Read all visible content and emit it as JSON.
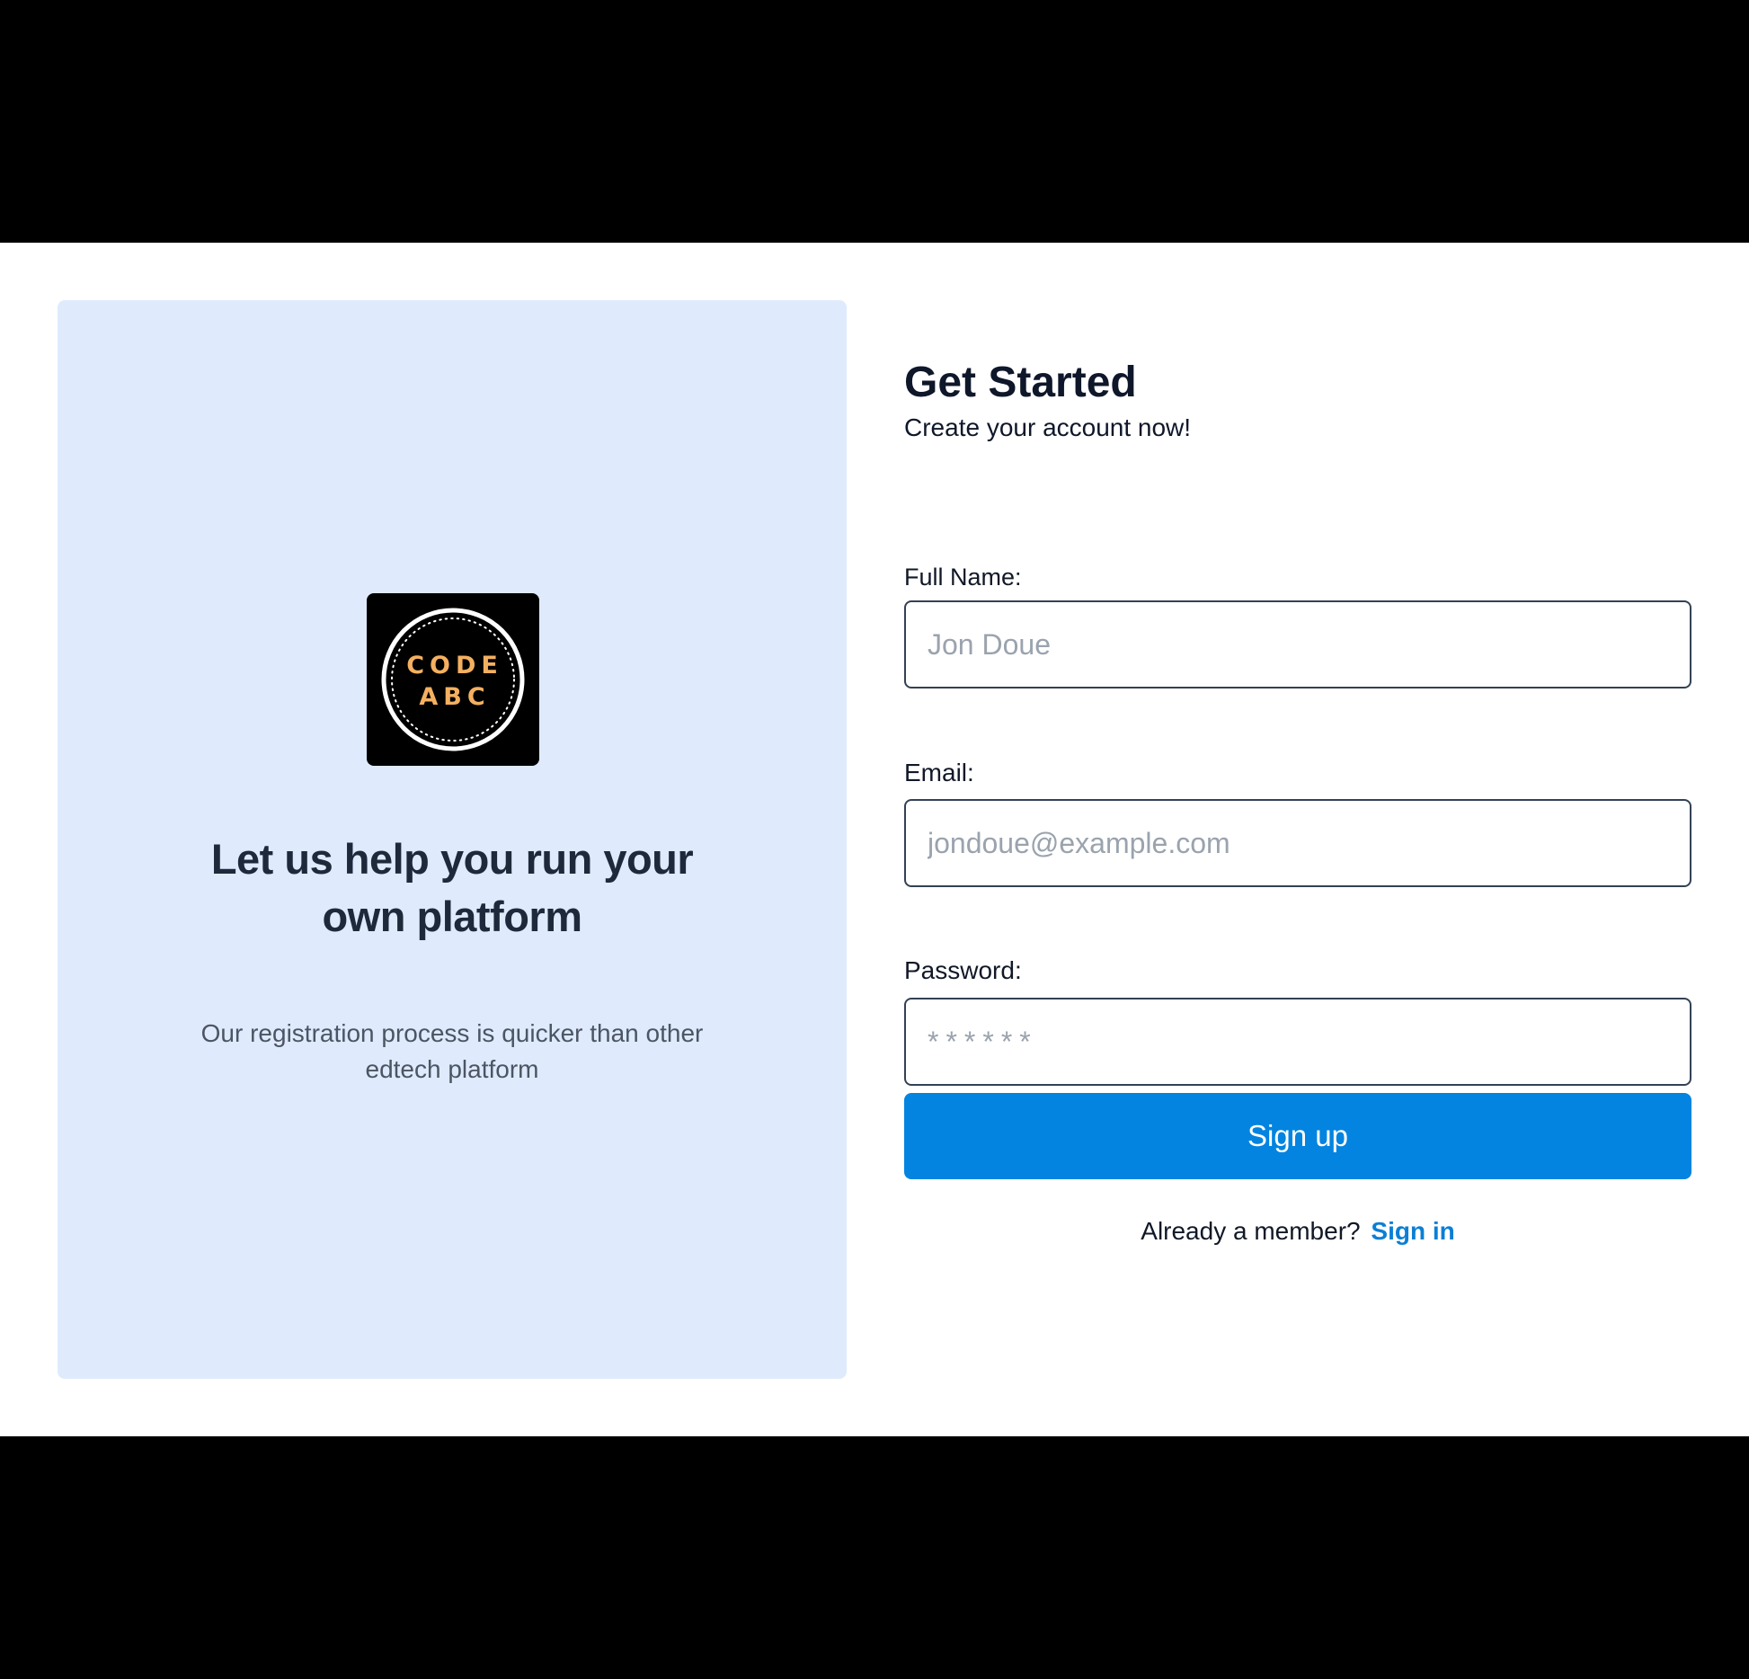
{
  "logo": {
    "line1": "CODE",
    "line2": "ABC",
    "text_color": "#f4b060",
    "background": "#000000"
  },
  "promo": {
    "heading": "Let us help you run your own platform",
    "text": "Our registration process is quicker than other edtech platform"
  },
  "form": {
    "title": "Get Started",
    "subtitle": "Create your account now!",
    "fields": {
      "full_name": {
        "label": "Full Name:",
        "placeholder": "Jon Doue"
      },
      "email": {
        "label": "Email:",
        "placeholder": "jondoue@example.com"
      },
      "password": {
        "label": "Password:",
        "placeholder": "******"
      }
    },
    "submit_label": "Sign up",
    "signin_prompt": "Already a member?",
    "signin_link": "Sign in"
  },
  "colors": {
    "accent": "#0284e0",
    "panel": "#dfeafd",
    "heading": "#1e293b"
  }
}
